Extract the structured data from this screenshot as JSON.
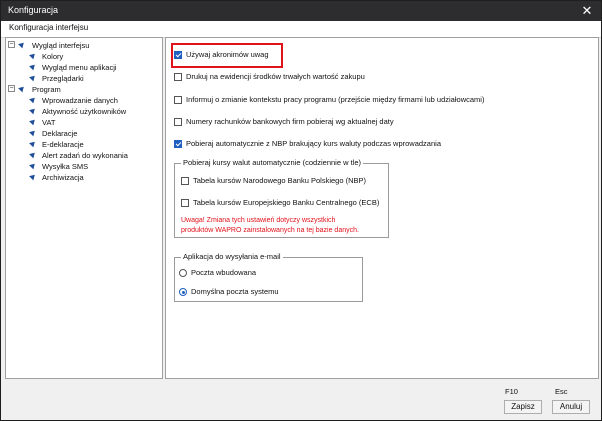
{
  "window": {
    "title": "Konfiguracja",
    "close_glyph": "✕"
  },
  "tab": {
    "label": "Konfiguracja interfejsu"
  },
  "tree": {
    "collapse_glyph": "−",
    "items": [
      {
        "label": "Wygląd interfejsu",
        "level": 0
      },
      {
        "label": "Kolory",
        "level": 1
      },
      {
        "label": "Wygląd menu aplikacji",
        "level": 1
      },
      {
        "label": "Przeglądarki",
        "level": 1
      },
      {
        "label": "Program",
        "level": 0
      },
      {
        "label": "Wprowadzanie danych",
        "level": 1
      },
      {
        "label": "Aktywność użytkowników",
        "level": 1
      },
      {
        "label": "VAT",
        "level": 1
      },
      {
        "label": "Deklaracje",
        "level": 1
      },
      {
        "label": "E-deklaracje",
        "level": 1
      },
      {
        "label": "Alert zadań do wykonania",
        "level": 1
      },
      {
        "label": "Wysyłka SMS",
        "level": 1
      },
      {
        "label": "Archiwizacja",
        "level": 1
      }
    ]
  },
  "settings": {
    "use_acronyms": {
      "label": "Używaj akronimów uwag",
      "checked": true
    },
    "print_fixed_assets": {
      "label": "Drukuj na ewidencji środków trwałych wartość zakupu",
      "checked": false
    },
    "context_change_info": {
      "label": "Informuj o zmianie kontekstu pracy programu (przejście między firmami lub udziałowcami)",
      "checked": false
    },
    "bank_account_numbers": {
      "label": "Numery rachunków bankowych firm pobieraj wg aktualnej daty",
      "checked": false
    },
    "nbp_auto_fetch": {
      "label": "Pobieraj automatycznie z NBP brakujący kurs waluty podczas wprowadzania",
      "checked": true
    },
    "rates_group": {
      "legend": "Pobieraj kursy walut automatycznie (codziennie w tle)",
      "nbp_table": {
        "label": "Tabela kursów Narodowego Banku Polskiego (NBP)",
        "checked": false
      },
      "ecb_table": {
        "label": "Tabela kursów Europejskiego Banku Centralnego (ECB)",
        "checked": false
      },
      "warning_line1": "Uwaga! Zmiana tych ustawień dotyczy wszystkich",
      "warning_line2": "produktów WAPRO zainstalowanych na tej bazie danych."
    },
    "email_group": {
      "legend": "Aplikacja do wysyłania e-mail",
      "builtin_mail": {
        "label": "Poczta wbudowana",
        "selected": false
      },
      "system_mail": {
        "label": "Domyślna poczta systemu",
        "selected": true
      }
    }
  },
  "footer": {
    "save_hotkey": "F10",
    "cancel_hotkey": "Esc",
    "save_label": "Zapisz",
    "cancel_label": "Anuluj"
  },
  "colors": {
    "accent": "#1f5fbf",
    "warning": "#e0121b",
    "titlebar": "#2d2d30"
  }
}
